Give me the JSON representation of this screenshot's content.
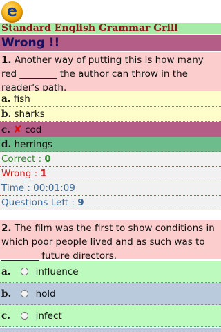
{
  "app": {
    "logo_letter": "e",
    "title": "Standard English Grammar Grill"
  },
  "result": {
    "text": "Wrong !!"
  },
  "question1": {
    "number": "1.",
    "text": "Another way of putting this is how many red ________ the author can throw in the reader's path.",
    "options": [
      {
        "letter": "a.",
        "text": "fish"
      },
      {
        "letter": "b.",
        "text": "sharks"
      },
      {
        "letter": "c.",
        "text": "cod",
        "mark": "✘"
      },
      {
        "letter": "d.",
        "text": "herrings"
      }
    ]
  },
  "stats": {
    "correct_label": "Correct : ",
    "correct_value": "0",
    "wrong_label": "Wrong : ",
    "wrong_value": "1",
    "time_label": "Time : 00:01:09",
    "left_label": "Questions Left : ",
    "left_value": "9"
  },
  "question2": {
    "number": "2.",
    "text": "The film was the first to show conditions in which poor people lived and as such was to ________ future directors.",
    "options": [
      {
        "letter": "a.",
        "text": "influence"
      },
      {
        "letter": "b.",
        "text": "hold"
      },
      {
        "letter": "c.",
        "text": "infect"
      }
    ]
  },
  "colors": {
    "title_bar": "#a8eaa8",
    "wrong_banner": "#b45d86",
    "question_bg": "#fccdcd",
    "correct_answer_bg": "#6cbc8c"
  }
}
